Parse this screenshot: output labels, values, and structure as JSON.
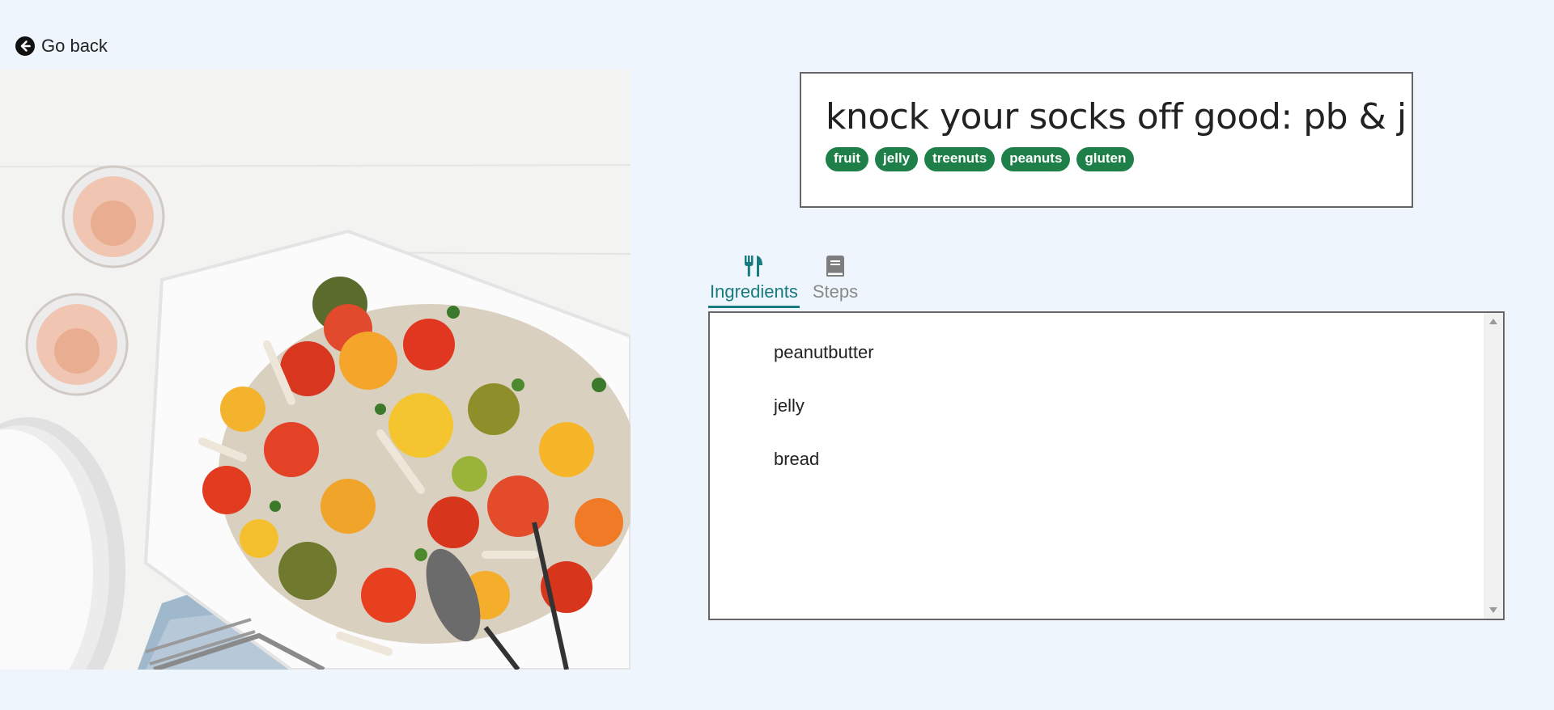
{
  "nav": {
    "back_label": "Go back",
    "back_icon": "arrow-circle-left-icon"
  },
  "recipe": {
    "title": "knock your socks off good: pb & j",
    "tags": [
      "fruit",
      "jelly",
      "treenuts",
      "peanuts",
      "gluten"
    ],
    "tag_color": "#1e8048"
  },
  "tabs": [
    {
      "label": "Ingredients",
      "icon": "utensils-icon",
      "active": true
    },
    {
      "label": "Steps",
      "icon": "book-icon",
      "active": false
    }
  ],
  "ingredients": [
    "peanutbutter",
    "jelly",
    "bread"
  ],
  "colors": {
    "background": "#eef5fd",
    "accent": "#177b80"
  }
}
